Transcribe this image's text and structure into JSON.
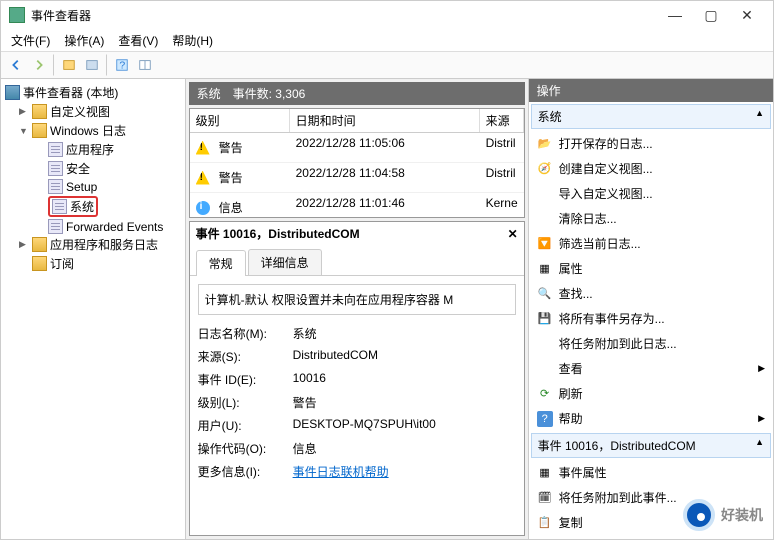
{
  "window": {
    "title": "事件查看器"
  },
  "menus": [
    "文件(F)",
    "操作(A)",
    "查看(V)",
    "帮助(H)"
  ],
  "tree": {
    "root": "事件查看器 (本地)",
    "custom_views": "自定义视图",
    "windows_logs": "Windows 日志",
    "logs": [
      "应用程序",
      "安全",
      "Setup",
      "系统",
      "Forwarded Events"
    ],
    "apps_services": "应用程序和服务日志",
    "subscriptions": "订阅"
  },
  "center": {
    "header_name": "系统",
    "header_count": "事件数: 3,306",
    "columns": {
      "level": "级别",
      "date": "日期和时间",
      "source": "来源"
    },
    "rows": [
      {
        "icon": "warn",
        "level": "警告",
        "date": "2022/12/28 11:05:06",
        "source": "Distril"
      },
      {
        "icon": "warn",
        "level": "警告",
        "date": "2022/12/28 11:04:58",
        "source": "Distril"
      },
      {
        "icon": "info",
        "level": "信息",
        "date": "2022/12/28 11:01:46",
        "source": "Kerne"
      }
    ],
    "detail_title": "事件 10016，DistributedCOM",
    "tabs": {
      "general": "常规",
      "details": "详细信息"
    },
    "detail_desc": "计算机-默认 权限设置并未向在应用程序容器 M",
    "fields": {
      "log_name_label": "日志名称(M):",
      "log_name": "系统",
      "source_label": "来源(S):",
      "source": "DistributedCOM",
      "event_id_label": "事件 ID(E):",
      "event_id": "10016",
      "level_label": "级别(L):",
      "level": "警告",
      "user_label": "用户(U):",
      "user": "DESKTOP-MQ7SPUH\\it00",
      "opcode_label": "操作代码(O):",
      "opcode": "信息",
      "more_label": "更多信息(I):",
      "more_link": "事件日志联机帮助"
    }
  },
  "actions": {
    "title": "操作",
    "section1": "系统",
    "items1": [
      "打开保存的日志...",
      "创建自定义视图...",
      "导入自定义视图...",
      "清除日志...",
      "筛选当前日志...",
      "属性",
      "查找...",
      "将所有事件另存为...",
      "将任务附加到此日志...",
      "查看",
      "刷新",
      "帮助"
    ],
    "section2": "事件 10016，DistributedCOM",
    "items2": [
      "事件属性",
      "将任务附加到此事件...",
      "复制"
    ]
  },
  "watermark": "好装机"
}
